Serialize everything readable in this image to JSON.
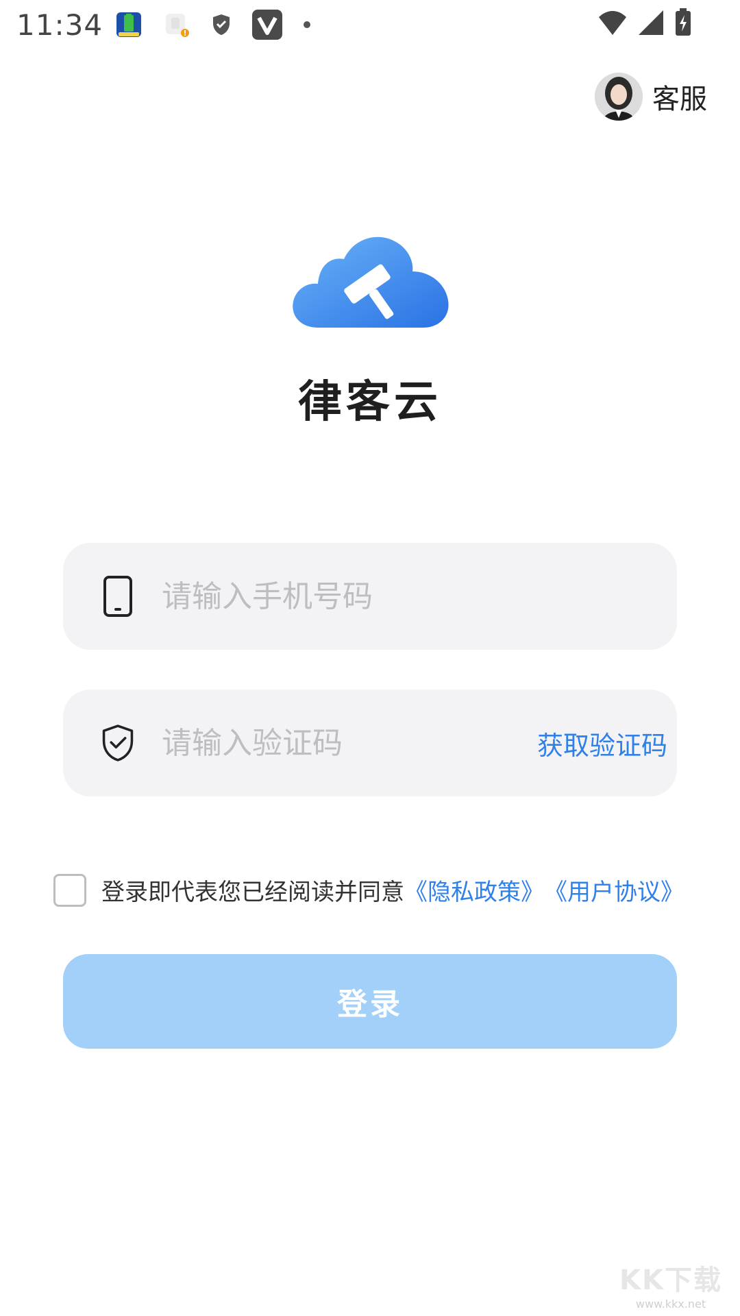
{
  "status_bar": {
    "time": "11:34",
    "left_icons": [
      "battery-app-icon",
      "notification-app-icon",
      "shield-icon",
      "vpn-v-icon",
      "dot-icon"
    ],
    "right_icons": [
      "wifi-icon",
      "cellular-signal-icon",
      "battery-charging-icon"
    ]
  },
  "header": {
    "customer_service_label": "客服",
    "avatar_icon": "avatar"
  },
  "brand": {
    "app_name": "律客云",
    "logo_icon": "cloud-gavel-logo",
    "logo_colors": [
      "#5aa8f7",
      "#2a76e6"
    ]
  },
  "form": {
    "phone": {
      "placeholder": "请输入手机号码",
      "value": "",
      "icon": "phone-icon"
    },
    "code": {
      "placeholder": "请输入验证码",
      "value": "",
      "icon": "shield-check-icon",
      "get_code_label": "获取验证码"
    },
    "agreement": {
      "checked": false,
      "text": "登录即代表您已经阅读并同意",
      "privacy_link": "《隐私政策》",
      "user_agreement_link": "《用户协议》"
    },
    "login_label": "登录"
  },
  "watermark": {
    "text": "KK下载",
    "url_text": "www.kkx.net"
  },
  "colors": {
    "accent": "#2f80e8",
    "button_disabled": "#a3d0f8",
    "input_bg": "#f3f3f5"
  }
}
